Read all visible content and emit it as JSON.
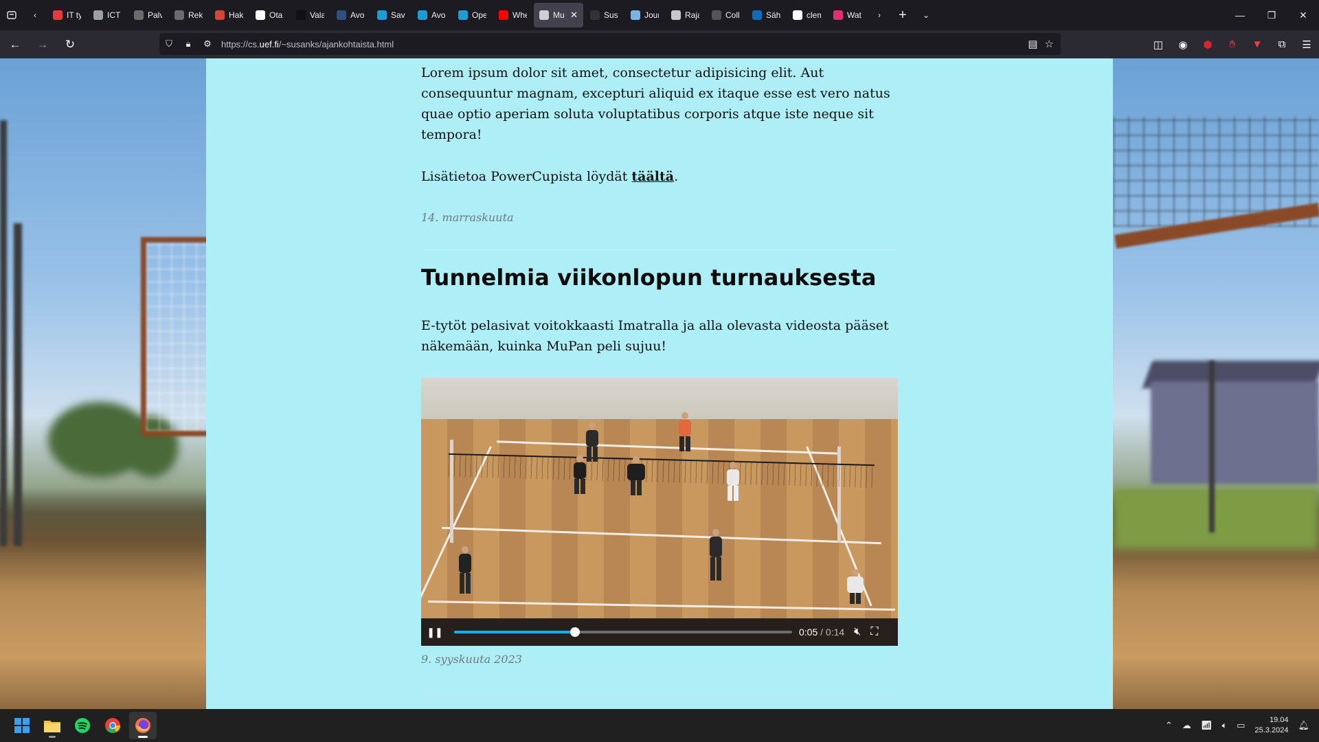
{
  "browser": {
    "tabs": [
      {
        "label": "IT työp",
        "color": "#e33a3a"
      },
      {
        "label": "ICT | E",
        "color": "#9ba0a6"
      },
      {
        "label": "Palvel",
        "color": "#6b6b6b"
      },
      {
        "label": "Rekry",
        "color": "#6b6b6b"
      },
      {
        "label": "Haken",
        "color": "#d64535"
      },
      {
        "label": "Ota yl",
        "color": "#ffffff"
      },
      {
        "label": "Valam",
        "color": "#111111"
      },
      {
        "label": "Avoin",
        "color": "#2f4f7f"
      },
      {
        "label": "Savon",
        "color": "#1d9bd7"
      },
      {
        "label": "Avoin",
        "color": "#1d9bd7"
      },
      {
        "label": "Opett",
        "color": "#1d9bd7"
      },
      {
        "label": "When",
        "color": "#ff0000"
      },
      {
        "label": "Mu",
        "color": "#cfcfd6",
        "active": true
      },
      {
        "label": "Susan",
        "color": "#333333"
      },
      {
        "label": "Journ",
        "color": "#7bb3e6"
      },
      {
        "label": "Raja N",
        "color": "#c8c8c8"
      },
      {
        "label": "Collis",
        "color": "#555555"
      },
      {
        "label": "Sähkö",
        "color": "#0f6cbd"
      },
      {
        "label": "cleme",
        "color": "#ffffff"
      },
      {
        "label": "Watch",
        "color": "#e0306e"
      }
    ],
    "url_prefix": "https://cs.",
    "url_domain": "uef.fi",
    "url_path": "/~susanks/ajankohtaista.html"
  },
  "page": {
    "intro_paragraph": "Lorem ipsum dolor sit amet, consectetur adipisicing elit. Aut consequuntur magnam, excepturi aliquid ex itaque esse est vero natus quae optio aperiam soluta voluptatibus corporis atque iste neque sit tempora!",
    "more_info_text": "Lisätietoa PowerCupista löydät ",
    "more_info_link": "täältä",
    "more_info_end": ".",
    "date_1": "14. marraskuuta",
    "headline": "Tunnelmia viikonlopun turnauksesta",
    "body_paragraph": "E-tytöt pelasivat voitokkaasti Imatralla ja alla olevasta videosta pääset näkemään, kuinka MuPan peli sujuu!",
    "date_2": "9. syyskuuta 2023",
    "video": {
      "current_time": "0:05",
      "separator": " / ",
      "duration": "0:14",
      "progress": 0.357
    }
  },
  "taskbar": {
    "time": "19.04",
    "date": "25.3.2024"
  },
  "colors": {
    "content_bg": "#aeeef6",
    "progress": "#00b3f4"
  }
}
